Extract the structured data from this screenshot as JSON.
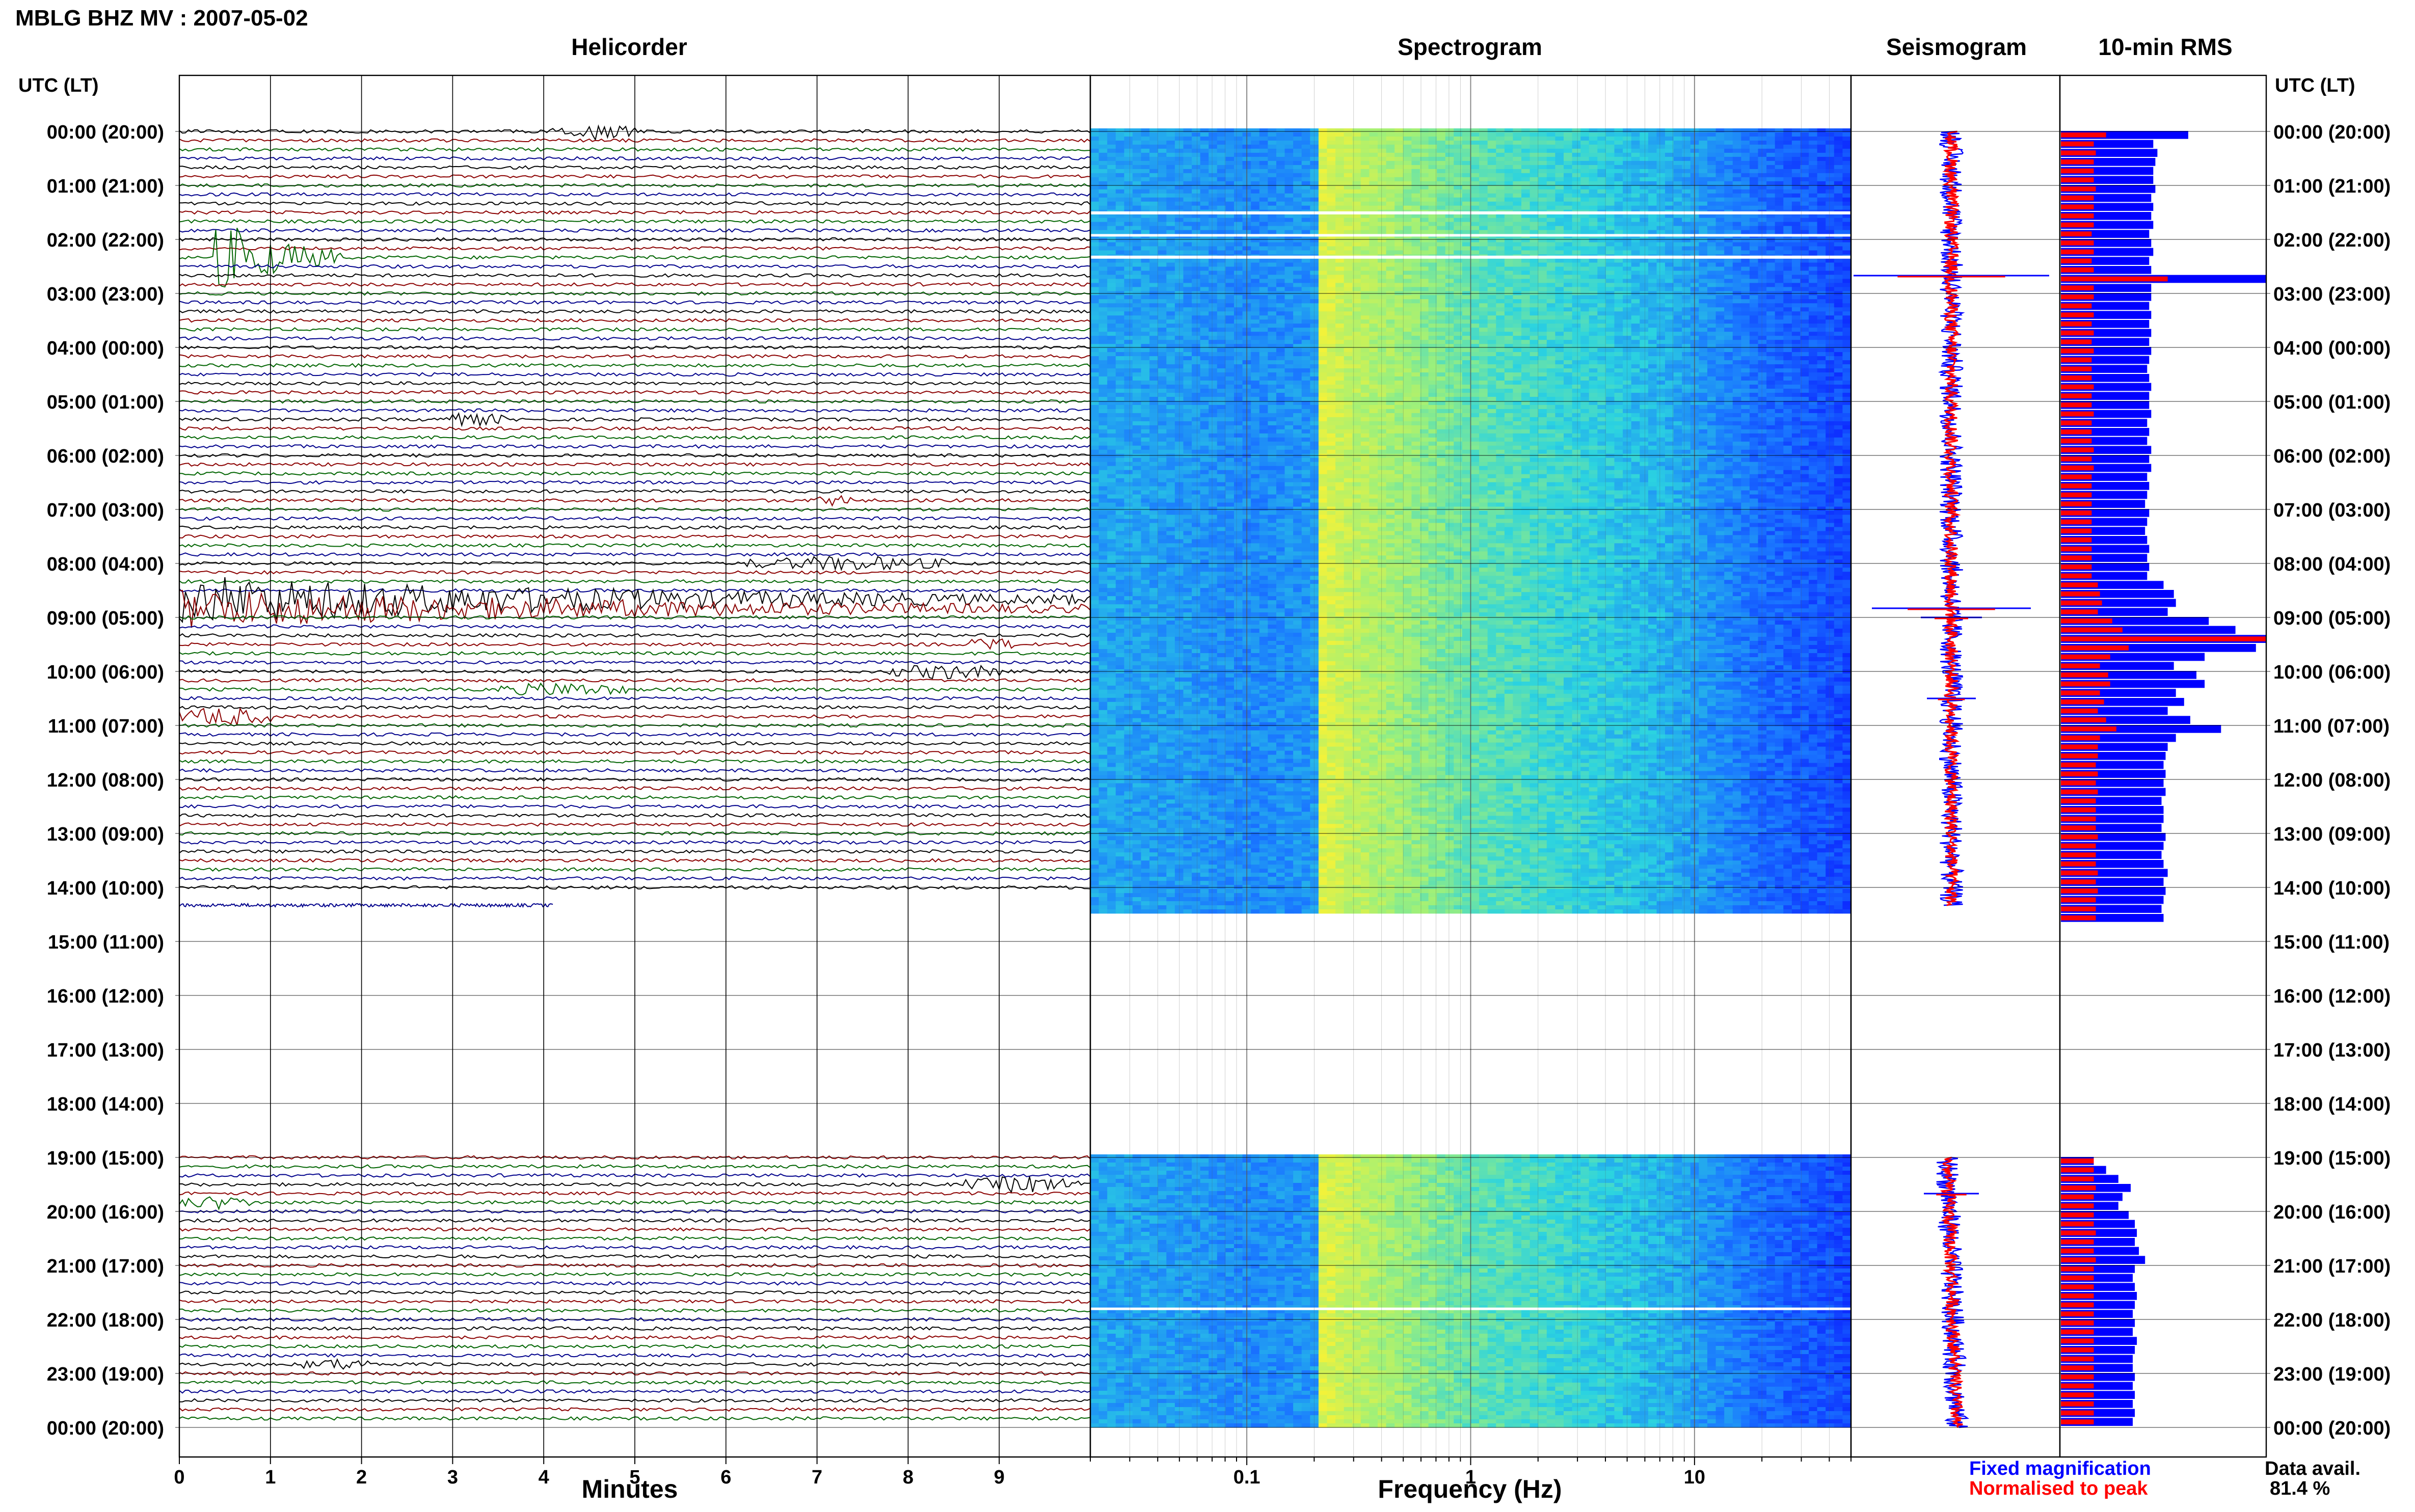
{
  "page_title": "MBLG BHZ MV : 2007-05-02",
  "panels": {
    "helicorder": "Helicorder",
    "spectrogram": "Spectrogram",
    "seismogram": "Seismogram",
    "rms": "10-min RMS"
  },
  "axis_titles": {
    "left_time": "UTC (LT)",
    "right_time": "UTC (LT)",
    "helicorder_x": "Minutes",
    "spectrogram_x": "Frequency (Hz)"
  },
  "legend": {
    "fixed": "Fixed magnification",
    "normalised": "Normalised to peak",
    "fixed_color": "#0000ff",
    "normalised_color": "#ff0000"
  },
  "availability": {
    "label": "Data avail.",
    "value": "81.4 %"
  },
  "colors": {
    "trace_cycle": [
      "#000000",
      "#8b0000",
      "#006400",
      "#00008b"
    ],
    "fixed": "#0000ff",
    "normalised": "#ff0000",
    "grid": "#000000"
  },
  "chart_data": {
    "type": "heatmap",
    "rows_per_hour": 6,
    "time_labels": [
      "00:00 (20:00)",
      "01:00 (21:00)",
      "02:00 (22:00)",
      "03:00 (23:00)",
      "04:00 (00:00)",
      "05:00 (01:00)",
      "06:00 (02:00)",
      "07:00 (03:00)",
      "08:00 (04:00)",
      "09:00 (05:00)",
      "10:00 (06:00)",
      "11:00 (07:00)",
      "12:00 (08:00)",
      "13:00 (09:00)",
      "14:00 (10:00)",
      "15:00 (11:00)",
      "16:00 (12:00)",
      "17:00 (13:00)",
      "18:00 (14:00)",
      "19:00 (15:00)",
      "20:00 (16:00)",
      "21:00 (17:00)",
      "22:00 (18:00)",
      "23:00 (19:00)",
      "00:00 (20:00)"
    ],
    "helicorder": {
      "xlabel": "Minutes",
      "x_ticks": [
        0,
        1,
        2,
        3,
        4,
        5,
        6,
        7,
        8,
        9
      ],
      "xlim": [
        0,
        10
      ],
      "data_segments_utc": [
        [
          0.0,
          14.25
        ],
        [
          19.0,
          24.0
        ]
      ],
      "last_partial_row": {
        "hour": 14.33,
        "minutes_recorded": 4.1
      },
      "events": [
        {
          "utc_hour": 0.0,
          "minute_start": 4.1,
          "minute_end": 5.0,
          "amplitude": 1.5
        },
        {
          "utc_hour": 2.33,
          "minute_start": 0.4,
          "minute_end": 1.8,
          "amplitude": 6.5
        },
        {
          "utc_hour": 5.33,
          "minute_start": 2.8,
          "minute_end": 3.6,
          "amplitude": 1.2
        },
        {
          "utc_hour": 6.83,
          "minute_start": 7.0,
          "minute_end": 7.4,
          "amplitude": 1.0
        },
        {
          "utc_hour": 8.0,
          "minute_start": 6.2,
          "minute_end": 8.5,
          "amplitude": 1.4
        },
        {
          "utc_hour": 8.67,
          "minute_start": 0.0,
          "minute_end": 10.0,
          "amplitude": 5.0
        },
        {
          "utc_hour": 8.83,
          "minute_start": 0.0,
          "minute_end": 10.0,
          "amplitude": 4.0
        },
        {
          "utc_hour": 9.5,
          "minute_start": 8.6,
          "minute_end": 9.2,
          "amplitude": 1.2
        },
        {
          "utc_hour": 10.0,
          "minute_start": 7.8,
          "minute_end": 9.0,
          "amplitude": 1.5
        },
        {
          "utc_hour": 10.33,
          "minute_start": 3.5,
          "minute_end": 4.9,
          "amplitude": 1.3
        },
        {
          "utc_hour": 10.83,
          "minute_start": 0.0,
          "minute_end": 1.0,
          "amplitude": 2.0
        },
        {
          "utc_hour": 19.5,
          "minute_start": 8.6,
          "minute_end": 9.9,
          "amplitude": 1.6
        },
        {
          "utc_hour": 19.83,
          "minute_start": 0.0,
          "minute_end": 0.8,
          "amplitude": 1.2
        },
        {
          "utc_hour": 22.83,
          "minute_start": 1.3,
          "minute_end": 2.2,
          "amplitude": 1.0
        }
      ]
    },
    "spectrogram": {
      "xlabel": "Frequency (Hz)",
      "x_scale": "log",
      "xlim": [
        0.02,
        50
      ],
      "x_tick_labels": [
        "0.1",
        "1",
        "10"
      ],
      "colormap": [
        "#0a1aff",
        "#1a78ff",
        "#2bd3e0",
        "#9df07a",
        "#f2f23a"
      ],
      "band_profile": [
        {
          "freq_hz": 0.02,
          "level": 0.38
        },
        {
          "freq_hz": 0.05,
          "level": 0.35
        },
        {
          "freq_hz": 0.1,
          "level": 0.3
        },
        {
          "freq_hz": 0.2,
          "level": 0.33
        },
        {
          "freq_hz": 0.21,
          "level": 0.95
        },
        {
          "freq_hz": 0.3,
          "level": 0.85
        },
        {
          "freq_hz": 0.6,
          "level": 0.72
        },
        {
          "freq_hz": 1.0,
          "level": 0.62
        },
        {
          "freq_hz": 3.0,
          "level": 0.52
        },
        {
          "freq_hz": 8.0,
          "level": 0.4
        },
        {
          "freq_hz": 20.0,
          "level": 0.22
        },
        {
          "freq_hz": 50.0,
          "level": 0.12
        }
      ]
    },
    "seismogram": {
      "series": [
        {
          "name": "Fixed magnification",
          "color": "#0000ff"
        },
        {
          "name": "Normalised to peak",
          "color": "#ff0000"
        }
      ],
      "spikes": [
        {
          "utc_hour": 2.67,
          "amplitude": 3.2
        },
        {
          "utc_hour": 8.83,
          "amplitude": 2.6
        },
        {
          "utc_hour": 9.0,
          "amplitude": 1.0
        },
        {
          "utc_hour": 10.5,
          "amplitude": 0.8
        },
        {
          "utc_hour": 19.67,
          "amplitude": 0.9
        }
      ]
    },
    "rms_10min": {
      "series": [
        {
          "name": "Fixed magnification",
          "color": "#0000ff"
        },
        {
          "name": "Normalised to peak",
          "color": "#ff0000"
        }
      ],
      "fixed_values": [
        0.62,
        0.45,
        0.47,
        0.46,
        0.45,
        0.45,
        0.46,
        0.44,
        0.45,
        0.44,
        0.45,
        0.43,
        0.44,
        0.45,
        0.43,
        0.44,
        1.0,
        0.44,
        0.44,
        0.43,
        0.44,
        0.43,
        0.44,
        0.43,
        0.44,
        0.43,
        0.42,
        0.43,
        0.44,
        0.43,
        0.43,
        0.44,
        0.42,
        0.43,
        0.42,
        0.44,
        0.43,
        0.44,
        0.42,
        0.43,
        0.42,
        0.41,
        0.43,
        0.42,
        0.41,
        0.42,
        0.43,
        0.42,
        0.43,
        0.42,
        0.5,
        0.55,
        0.56,
        0.52,
        0.72,
        0.85,
        1.0,
        0.95,
        0.7,
        0.55,
        0.66,
        0.7,
        0.56,
        0.6,
        0.52,
        0.63,
        0.78,
        0.56,
        0.52,
        0.51,
        0.5,
        0.51,
        0.5,
        0.51,
        0.49,
        0.5,
        0.5,
        0.49,
        0.51,
        0.5,
        0.49,
        0.5,
        0.52,
        0.5,
        0.51,
        0.5,
        0.49,
        0.5
      ],
      "normalised_values": [
        0.22,
        0.16,
        0.17,
        0.16,
        0.16,
        0.16,
        0.17,
        0.16,
        0.16,
        0.16,
        0.16,
        0.15,
        0.16,
        0.16,
        0.15,
        0.16,
        0.52,
        0.16,
        0.16,
        0.15,
        0.16,
        0.15,
        0.16,
        0.15,
        0.16,
        0.15,
        0.15,
        0.15,
        0.16,
        0.15,
        0.15,
        0.16,
        0.15,
        0.15,
        0.15,
        0.16,
        0.15,
        0.16,
        0.15,
        0.15,
        0.15,
        0.15,
        0.15,
        0.15,
        0.15,
        0.15,
        0.15,
        0.15,
        0.15,
        0.15,
        0.18,
        0.19,
        0.2,
        0.18,
        0.25,
        0.3,
        1.0,
        0.33,
        0.24,
        0.19,
        0.23,
        0.24,
        0.19,
        0.21,
        0.18,
        0.22,
        0.27,
        0.19,
        0.18,
        0.18,
        0.17,
        0.18,
        0.17,
        0.18,
        0.17,
        0.17,
        0.17,
        0.17,
        0.18,
        0.17,
        0.17,
        0.17,
        0.18,
        0.17,
        0.18,
        0.17,
        0.17,
        0.17
      ],
      "fixed_values_evening": [
        0.16,
        0.22,
        0.28,
        0.34,
        0.3,
        0.28,
        0.33,
        0.36,
        0.37,
        0.36,
        0.38,
        0.41,
        0.36,
        0.35,
        0.36,
        0.37,
        0.36,
        0.35,
        0.36,
        0.35,
        0.37,
        0.36,
        0.35,
        0.35,
        0.36,
        0.35,
        0.36,
        0.35,
        0.36,
        0.35
      ],
      "normalised_values_evening": [
        0.16,
        0.16,
        0.16,
        0.17,
        0.16,
        0.16,
        0.16,
        0.16,
        0.17,
        0.16,
        0.16,
        0.17,
        0.16,
        0.16,
        0.16,
        0.16,
        0.16,
        0.16,
        0.16,
        0.16,
        0.16,
        0.16,
        0.16,
        0.16,
        0.16,
        0.16,
        0.16,
        0.16,
        0.16,
        0.16
      ]
    }
  }
}
